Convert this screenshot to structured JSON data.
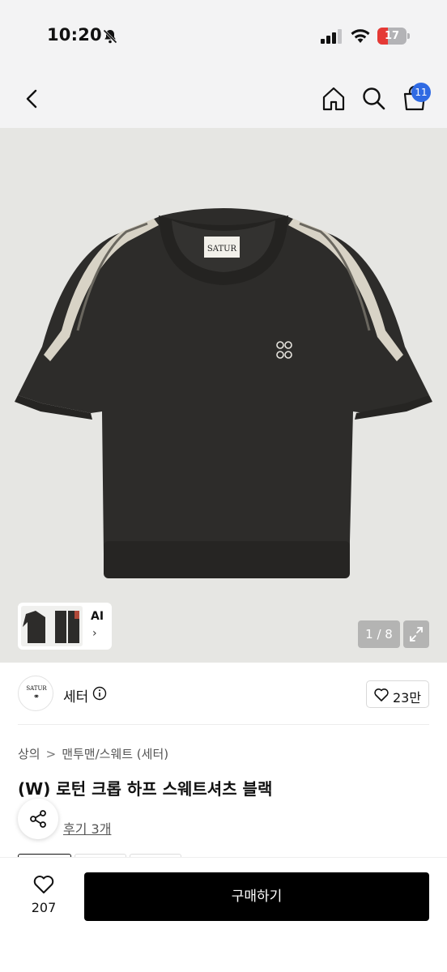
{
  "status_bar": {
    "time": "10:20",
    "battery": "17",
    "battery_color": "#e53935",
    "icons": [
      "bell-off-icon",
      "signal-icon",
      "wifi-icon",
      "battery-icon"
    ]
  },
  "nav": {
    "back_icon": "chevron-left-icon",
    "home_icon": "home-icon",
    "search_icon": "search-icon",
    "cart_icon": "shopping-bag-icon",
    "cart_badge": "11",
    "badge_color": "#2f6ae3"
  },
  "gallery": {
    "thumb_label": "AI",
    "thumb_arrow": "›",
    "counter": "1 / 8",
    "expand_icon": "expand-icon",
    "collar_label": "SATUR"
  },
  "brand": {
    "logo_text": "SATUR",
    "name": "세터",
    "like_count": "23만"
  },
  "product": {
    "breadcrumb": [
      "상의",
      "맨투맨/스웨트 (세터)"
    ],
    "breadcrumb_sep": ">",
    "title": "(W) 로턴 크롭 하프 스웨트셔츠 블랙",
    "review_link": "후기 3개"
  },
  "bottom": {
    "wish_count": "207",
    "buy_label": "구매하기"
  }
}
